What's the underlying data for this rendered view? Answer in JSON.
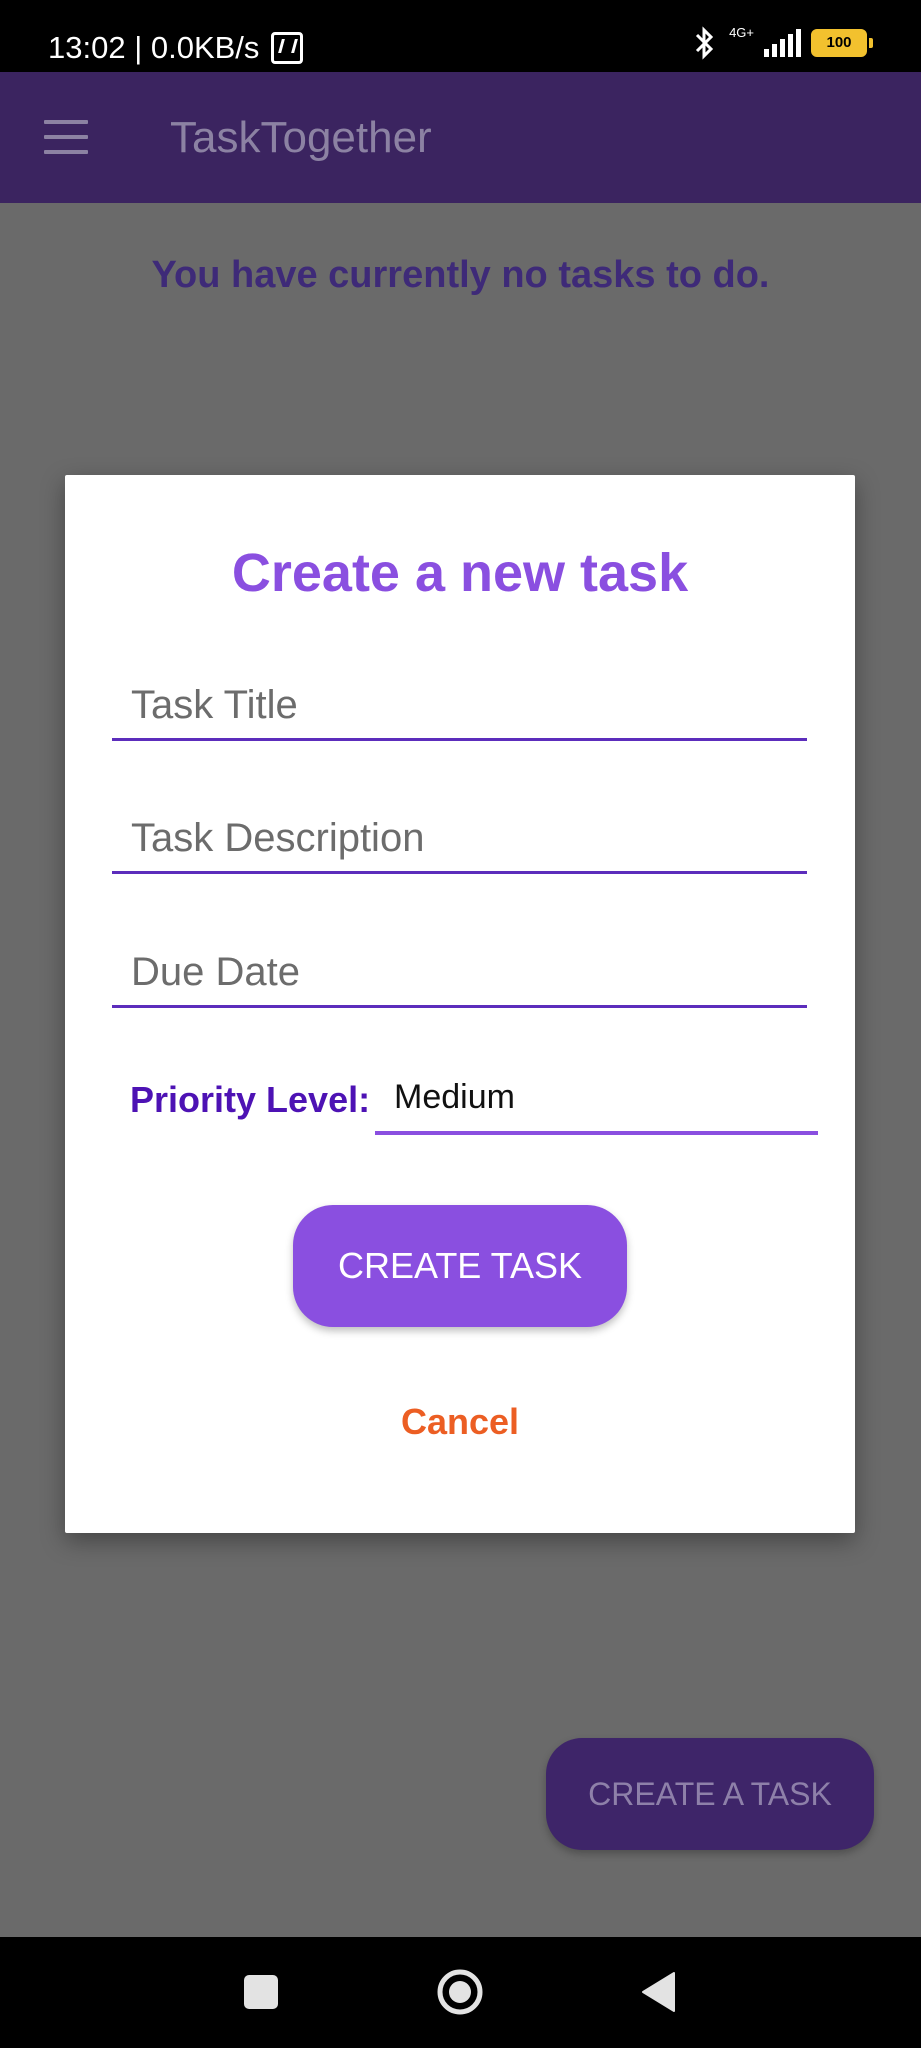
{
  "status_bar": {
    "time_speed": "13:02 | 0.0KB/s",
    "network_label": "4G+",
    "battery_level": "100"
  },
  "app_bar": {
    "title": "TaskTogether"
  },
  "main": {
    "empty_message": "You have currently no tasks to do.",
    "fab_label": "CREATE A TASK"
  },
  "dialog": {
    "title": "Create a new task",
    "fields": {
      "title_placeholder": "Task Title",
      "description_placeholder": "Task Description",
      "due_date_placeholder": "Due Date"
    },
    "priority": {
      "label": "Priority Level:",
      "value": "Medium"
    },
    "create_button": "CREATE TASK",
    "cancel_button": "Cancel"
  },
  "colors": {
    "accent": "#8a4fe0",
    "app_bar": "#3b2460",
    "cancel": "#ec5e23",
    "priority_label": "#4d12b4"
  }
}
